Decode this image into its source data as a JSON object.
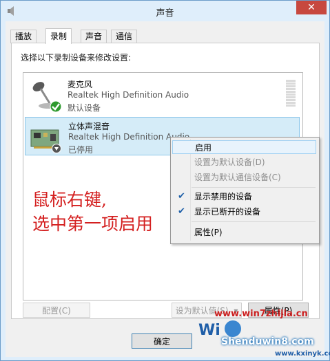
{
  "window": {
    "title": "声音",
    "close_glyph": "✕"
  },
  "tabs": [
    {
      "label": "播放"
    },
    {
      "label": "录制"
    },
    {
      "label": "声音"
    },
    {
      "label": "通信"
    }
  ],
  "panel": {
    "prompt": "选择以下录制设备来修改设置:"
  },
  "devices": [
    {
      "name": "麦克风",
      "driver": "Realtek High Definition Audio",
      "status": "默认设备",
      "icon": "microphone-icon",
      "badge": "green-check-badge"
    },
    {
      "name": "立体声混音",
      "driver": "Realtek High Definition Audio",
      "status": "已停用",
      "icon": "sound-card-icon",
      "badge": "disabled-arrow-badge"
    }
  ],
  "annotation": {
    "line1": "鼠标右键,",
    "line2": "选中第一项启用"
  },
  "buttons": {
    "configure": "配置(C)",
    "set_default": "设为默认值(S)",
    "properties": "属性(P)",
    "ok": "确定"
  },
  "context_menu": {
    "items": [
      {
        "label": "启用",
        "state": "hover"
      },
      {
        "label": "设置为默认设备(D)",
        "state": "disabled"
      },
      {
        "label": "设置为默认通信设备(C)",
        "state": "disabled"
      },
      {
        "label": "显示禁用的设备",
        "checked": true
      },
      {
        "label": "显示已断开的设备",
        "checked": true
      },
      {
        "label": "属性(P)"
      }
    ],
    "check_glyph": "✔"
  },
  "watermarks": {
    "url1": "www.win7zhijia.cn",
    "logo": "Shenduwin8.com",
    "url2": "www.kxinyk.com"
  },
  "colors": {
    "accent": "#3c7fb1",
    "annotation": "#d42020",
    "close": "#c7483f"
  }
}
